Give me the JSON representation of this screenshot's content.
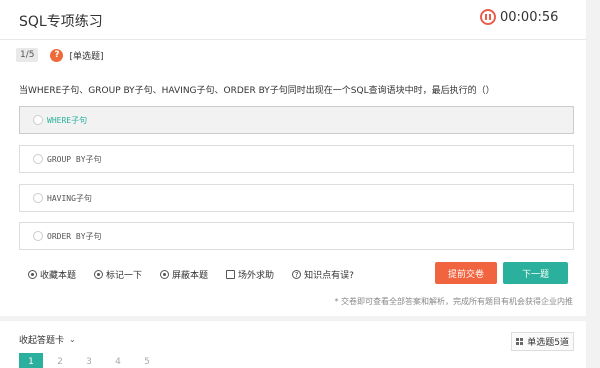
{
  "header": {
    "title": "SQL专项练习",
    "timer": "00:00:56"
  },
  "meta": {
    "progress": "1/5",
    "question_icon": "?",
    "type": "[单选题]"
  },
  "question": "当WHERE子句、GROUP BY子句、HAVING子句、ORDER BY子句同时出现在一个SQL查询语块中时，最后执行的（）",
  "options": [
    {
      "label": "WHERE子句",
      "selected": true
    },
    {
      "label": "GROUP BY子句",
      "selected": false
    },
    {
      "label": "HAVING子句",
      "selected": false
    },
    {
      "label": "ORDER BY子句",
      "selected": false
    }
  ],
  "tools": [
    "收藏本题",
    "标记一下",
    "屏蔽本题",
    "场外求助",
    "知识点有误?"
  ],
  "buttons": {
    "submit": "提前交卷",
    "next": "下一题"
  },
  "hint": "* 交卷即可查看全部答案和解析，完成所有题目有机会获得企业内推",
  "sheet": {
    "collapse": "收起答题卡",
    "right": "单选题5道",
    "numbers": [
      "1",
      "2",
      "3",
      "4",
      "5"
    ]
  },
  "colors": {
    "accent": "#2ab09c",
    "warn": "#f0643f",
    "timer": "#e8604c"
  },
  "icons": [
    "pause-circle-icon",
    "question-icon",
    "star-icon",
    "check-icon",
    "shield-icon",
    "share-icon",
    "help-icon",
    "chevron-down-icon",
    "grid-icon"
  ]
}
